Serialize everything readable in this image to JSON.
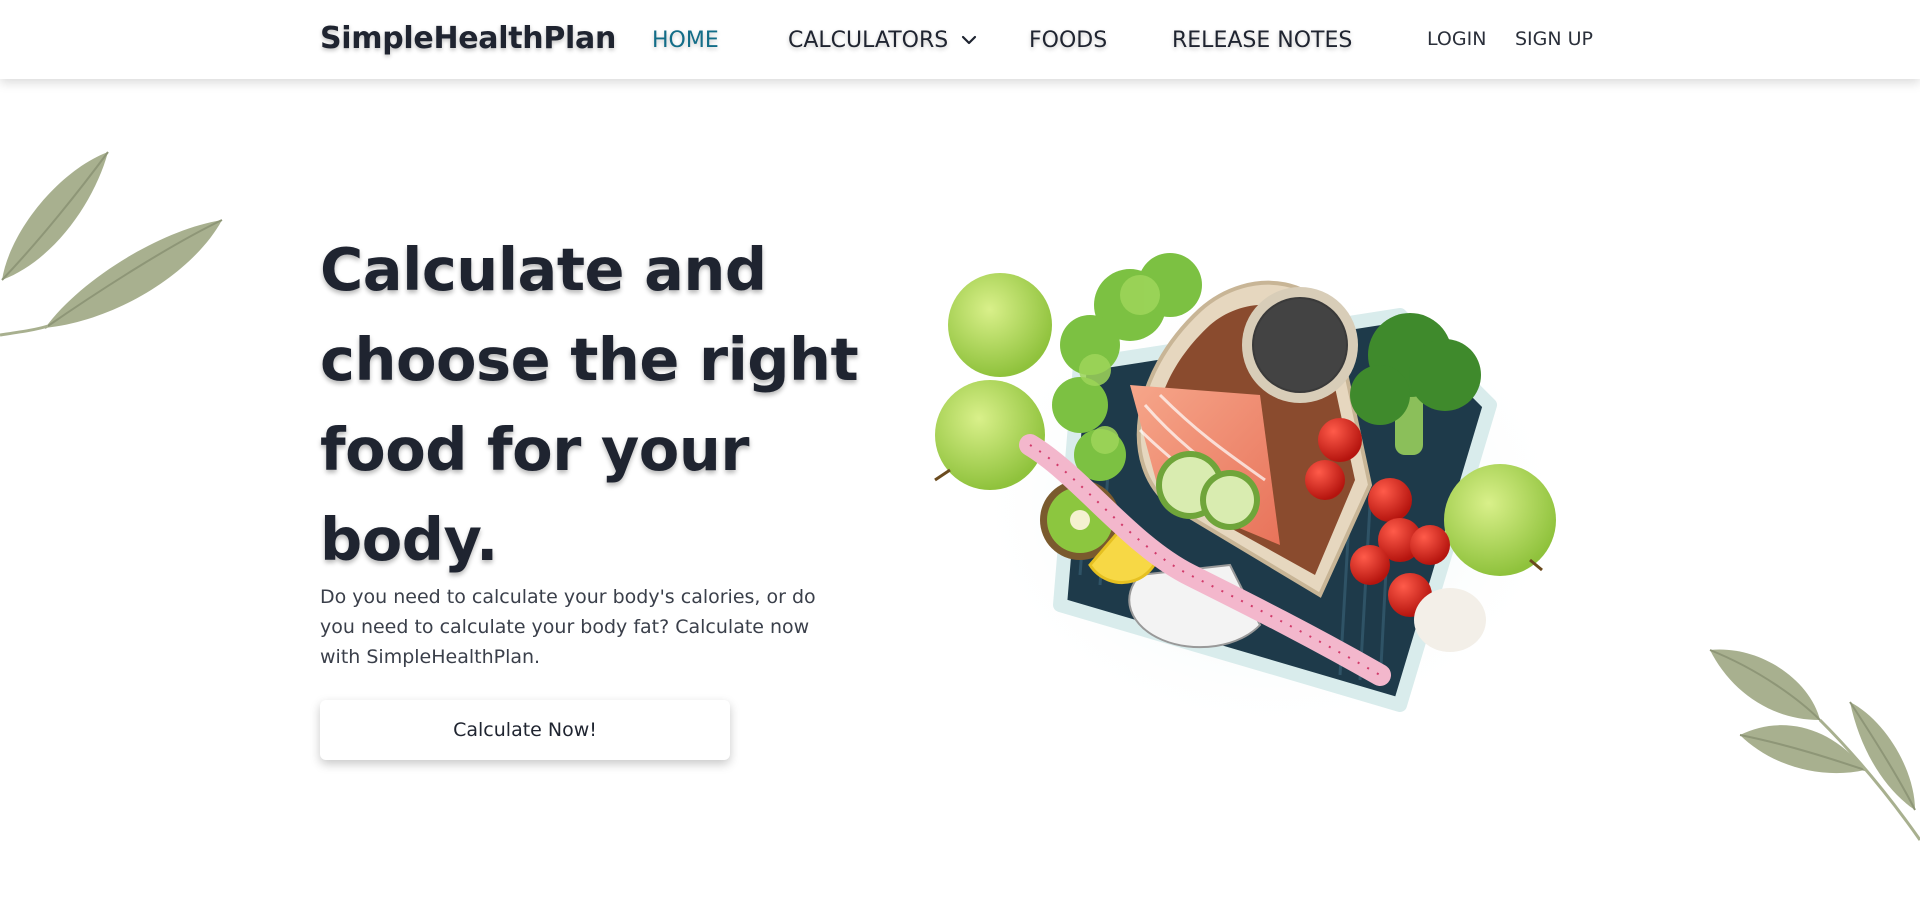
{
  "brand": {
    "name": "SimpleHealthPlan"
  },
  "nav": {
    "home": "HOME",
    "calculators": "CALCULATORS",
    "foods": "FOODS",
    "release_notes": "RELEASE NOTES"
  },
  "auth": {
    "login": "LOGIN",
    "signup": "SIGN UP"
  },
  "hero": {
    "title": "Calculate and choose the right food for your body.",
    "description": "Do you need to calculate your body's calories, or do you need to calculate your body fat? Calculate now with SimpleHealthPlan.",
    "cta": "Calculate Now!"
  },
  "colors": {
    "accent": "#136d88",
    "text": "#1f2430",
    "leaf": "#a8b08f"
  },
  "icons": {
    "dropdown": "chevron-down-icon",
    "decor_top_left": "leaf-icon",
    "decor_bottom_right": "leaf-branch-icon"
  }
}
